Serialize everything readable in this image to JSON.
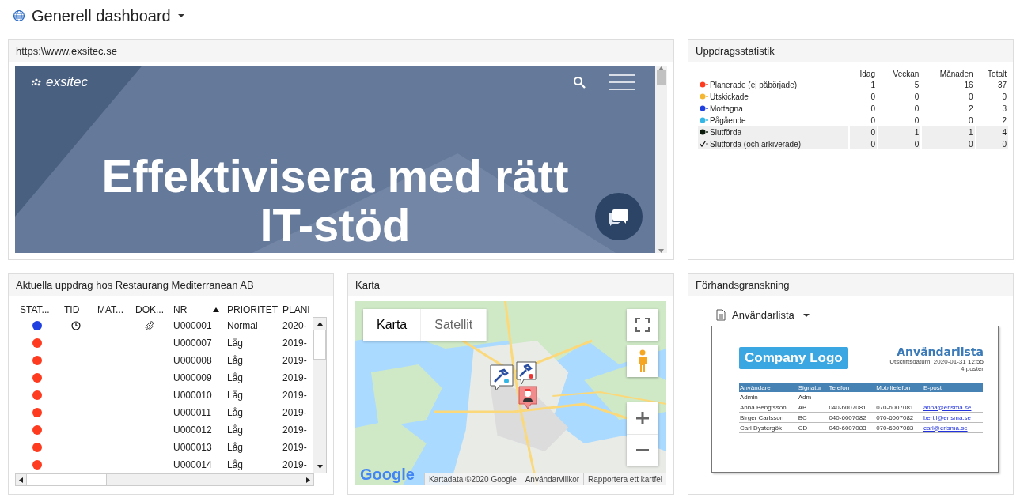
{
  "dashboard": {
    "title": "Generell dashboard"
  },
  "web_panel": {
    "title": "https:\\\\www.exsitec.se",
    "site_logo": "exsitec",
    "headline": "Effektivisera med rätt IT-stöd"
  },
  "stats_panel": {
    "title": "Uppdragsstatistik",
    "columns": [
      "Idag",
      "Veckan",
      "Månaden",
      "Totalt"
    ],
    "rows": [
      {
        "kind": "dot",
        "color": "#ff3b1f",
        "label": "Planerade (ej påbörjade)",
        "values": [
          "1",
          "5",
          "16",
          "37"
        ],
        "shaded": false
      },
      {
        "kind": "dot",
        "color": "#f5b731",
        "label": "Utskickade",
        "values": [
          "0",
          "0",
          "0",
          "0"
        ],
        "shaded": false
      },
      {
        "kind": "dot",
        "color": "#1f3fe0",
        "label": "Mottagna",
        "values": [
          "0",
          "0",
          "2",
          "3"
        ],
        "shaded": false
      },
      {
        "kind": "dot",
        "color": "#33b6e6",
        "label": "Pågående",
        "values": [
          "0",
          "0",
          "0",
          "2"
        ],
        "shaded": false
      },
      {
        "kind": "dot",
        "color": "#0a1a0a",
        "label": "Slutförda",
        "values": [
          "0",
          "1",
          "1",
          "4"
        ],
        "shaded": true
      },
      {
        "kind": "check",
        "label": "Slutförda (och arkiverade)",
        "values": [
          "0",
          "0",
          "0",
          "0"
        ],
        "shaded": true
      }
    ]
  },
  "orders_panel": {
    "title": "Aktuella uppdrag hos Restaurang Mediterranean AB",
    "columns": [
      {
        "label": "STAT...",
        "sorted": false
      },
      {
        "label": "TID",
        "sorted": false
      },
      {
        "label": "MAT...",
        "sorted": false
      },
      {
        "label": "DOK...",
        "sorted": false
      },
      {
        "label": "NR",
        "sorted": true
      },
      {
        "label": "PRIORITET",
        "sorted": false
      },
      {
        "label": "PLANI",
        "sorted": false
      }
    ],
    "rows": [
      {
        "color": "#1f3fe0",
        "time": true,
        "document": true,
        "nr": "U000001",
        "priority": "Normal",
        "planned": "2020-"
      },
      {
        "color": "#ff3b1f",
        "time": false,
        "document": false,
        "nr": "U000007",
        "priority": "Låg",
        "planned": "2019-"
      },
      {
        "color": "#ff3b1f",
        "time": false,
        "document": false,
        "nr": "U000008",
        "priority": "Låg",
        "planned": "2019-"
      },
      {
        "color": "#ff3b1f",
        "time": false,
        "document": false,
        "nr": "U000009",
        "priority": "Låg",
        "planned": "2019-"
      },
      {
        "color": "#ff3b1f",
        "time": false,
        "document": false,
        "nr": "U000010",
        "priority": "Låg",
        "planned": "2019-"
      },
      {
        "color": "#ff3b1f",
        "time": false,
        "document": false,
        "nr": "U000011",
        "priority": "Låg",
        "planned": "2019-"
      },
      {
        "color": "#ff3b1f",
        "time": false,
        "document": false,
        "nr": "U000012",
        "priority": "Låg",
        "planned": "2019-"
      },
      {
        "color": "#ff3b1f",
        "time": false,
        "document": false,
        "nr": "U000013",
        "priority": "Låg",
        "planned": "2019-"
      },
      {
        "color": "#ff3b1f",
        "time": false,
        "document": false,
        "nr": "U000014",
        "priority": "Låg",
        "planned": "2019-"
      }
    ]
  },
  "map_panel": {
    "title": "Karta",
    "map_types": [
      {
        "label": "Karta",
        "selected": true
      },
      {
        "label": "Satellit",
        "selected": false
      }
    ],
    "logo": "Google",
    "attribution": [
      "Kartadata ©2020 Google",
      "Användarvillkor",
      "Rapportera ett kartfel"
    ]
  },
  "preview_panel": {
    "title": "Förhandsgranskning",
    "report_select": "Användarlista",
    "document": {
      "logo": "Company Logo",
      "title": "Användarlista",
      "print_date": "Utskriftsdatum: 2020-01-31 12:55",
      "count": "4 poster",
      "columns": [
        "Användare",
        "Signatur",
        "Telefon",
        "Mobiltelefon",
        "E-post"
      ],
      "rows": [
        [
          "Admin",
          "Adm",
          "",
          "",
          ""
        ],
        [
          "Anna Bengtsson",
          "AB",
          "040-6007081",
          "070-6007081",
          "anna@erisma.se"
        ],
        [
          "Birger Carlsson",
          "BC",
          "040-6007082",
          "070-6007082",
          "bertil@erisma.se"
        ],
        [
          "Carl Dystergök",
          "CD",
          "040-6007083",
          "070-6007083",
          "carl@erisma.se"
        ]
      ]
    }
  }
}
